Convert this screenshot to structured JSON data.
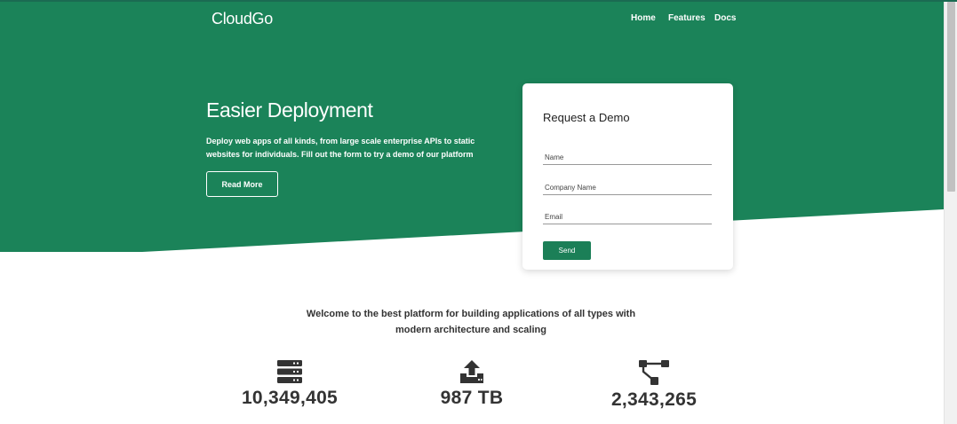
{
  "colors": {
    "brand_green": "#1b8359",
    "button_green": "#1b7f57",
    "text_dark": "#333333"
  },
  "nav": {
    "brand": "CloudGo",
    "links": [
      "Home",
      "Features",
      "Docs"
    ]
  },
  "hero": {
    "title": "Easier Deployment",
    "description": "Deploy web apps of all kinds, from large scale enterprise APIs to static websites for individuals. Fill out the form to try a demo of our platform",
    "button_label": "Read More"
  },
  "demo_form": {
    "title": "Request a Demo",
    "name_placeholder": "Name",
    "company_placeholder": "Company Name",
    "email_placeholder": "Email",
    "send_label": "Send"
  },
  "welcome": {
    "text": "Welcome to the best platform for building applications of all types with modern architecture and scaling"
  },
  "stats": [
    {
      "icon": "server-icon",
      "value": "10,349,405"
    },
    {
      "icon": "upload-icon",
      "value": "987 TB"
    },
    {
      "icon": "sitemap-icon",
      "value": "2,343,265"
    }
  ]
}
